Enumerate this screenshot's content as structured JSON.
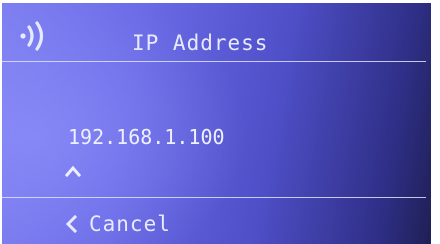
{
  "header": {
    "title": "IP Address",
    "status_icon": "wireless-signal-icon"
  },
  "main": {
    "ip_value": "192.168.1.100",
    "cursor_icon": "caret-up-icon"
  },
  "footer": {
    "cancel_label": "Cancel",
    "cancel_icon": "chevron-left-icon"
  },
  "colors": {
    "background_start": "#7c7ef0",
    "background_end": "#1f1f55",
    "text": "#e8eaff"
  }
}
